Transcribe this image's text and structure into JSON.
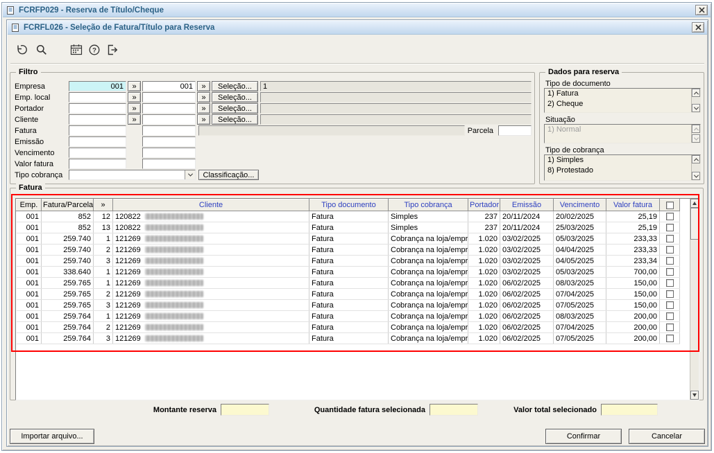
{
  "colors": {
    "annotation_red": "#ff0000",
    "link_blue": "#2d3fc0",
    "highlight_cyan": "#ccf4f6",
    "total_yellow": "#fcf9cf"
  },
  "window": {
    "title": "FCRFP029 - Reserva de Título/Cheque"
  },
  "dialog": {
    "title": "FCRFL026 - Seleção de Fatura/Título para Reserva"
  },
  "toolbar": {
    "icons": [
      "undo",
      "search",
      "calendar",
      "help",
      "exit"
    ]
  },
  "filtro": {
    "legend": "Filtro",
    "zoom_button": "»",
    "selecao_button": "Seleção...",
    "rows": [
      {
        "label": "Empresa",
        "from": "001",
        "to": "001",
        "detail": "1"
      },
      {
        "label": "Emp. local",
        "from": "",
        "to": "",
        "detail": ""
      },
      {
        "label": "Portador",
        "from": "",
        "to": "",
        "detail": ""
      },
      {
        "label": "Cliente",
        "from": "",
        "to": "",
        "detail": ""
      }
    ],
    "fatura_row": {
      "label": "Fatura",
      "from": "",
      "to": "",
      "parcela_label": "Parcela",
      "parcela_value": ""
    },
    "range_rows": [
      {
        "label": "Emissão",
        "from": "",
        "to": ""
      },
      {
        "label": "Vencimento",
        "from": "",
        "to": ""
      },
      {
        "label": "Valor fatura",
        "from": "",
        "to": ""
      }
    ],
    "tipo_cobranca": {
      "label": "Tipo cobrança",
      "value": "",
      "classificacao_button": "Classificação..."
    }
  },
  "dados_reserva": {
    "legend": "Dados para reserva",
    "sections": [
      {
        "label": "Tipo de documento",
        "options": [
          "1) Fatura",
          "2) Cheque"
        ],
        "disabled": false
      },
      {
        "label": "Situação",
        "options": [
          "1) Normal"
        ],
        "disabled": true
      },
      {
        "label": "Tipo de cobrança",
        "options": [
          "1) Simples",
          "8) Protestado"
        ],
        "disabled": false
      }
    ]
  },
  "fatura_grid": {
    "legend": "Fatura",
    "headers": [
      {
        "label": "Emp.",
        "link": false
      },
      {
        "label": "Fatura/Parcela",
        "link": false
      },
      {
        "label": "»",
        "link": false
      },
      {
        "label": "Cliente",
        "link": true
      },
      {
        "label": "Tipo documento",
        "link": true
      },
      {
        "label": "Tipo cobrança",
        "link": true
      },
      {
        "label": "Portador",
        "link": true
      },
      {
        "label": "Emissão",
        "link": true
      },
      {
        "label": "Vencimento",
        "link": true
      },
      {
        "label": "Valor fatura",
        "link": true
      }
    ],
    "rows": [
      {
        "emp": "001",
        "fatura": "852",
        "parcela": "12",
        "cliente": "120822",
        "tipo_documento": "Fatura",
        "tipo_cobranca": "Simples",
        "portador": "237",
        "emissao": "20/11/2024",
        "vencimento": "20/02/2025",
        "valor": "25,19",
        "checked": false
      },
      {
        "emp": "001",
        "fatura": "852",
        "parcela": "13",
        "cliente": "120822",
        "tipo_documento": "Fatura",
        "tipo_cobranca": "Simples",
        "portador": "237",
        "emissao": "20/11/2024",
        "vencimento": "25/03/2025",
        "valor": "25,19",
        "checked": false
      },
      {
        "emp": "001",
        "fatura": "259.740",
        "parcela": "1",
        "cliente": "121269",
        "tipo_documento": "Fatura",
        "tipo_cobranca": "Cobrança na loja/empre",
        "portador": "1.020",
        "emissao": "03/02/2025",
        "vencimento": "05/03/2025",
        "valor": "233,33",
        "checked": false
      },
      {
        "emp": "001",
        "fatura": "259.740",
        "parcela": "2",
        "cliente": "121269",
        "tipo_documento": "Fatura",
        "tipo_cobranca": "Cobrança na loja/empre",
        "portador": "1.020",
        "emissao": "03/02/2025",
        "vencimento": "04/04/2025",
        "valor": "233,33",
        "checked": false
      },
      {
        "emp": "001",
        "fatura": "259.740",
        "parcela": "3",
        "cliente": "121269",
        "tipo_documento": "Fatura",
        "tipo_cobranca": "Cobrança na loja/empre",
        "portador": "1.020",
        "emissao": "03/02/2025",
        "vencimento": "04/05/2025",
        "valor": "233,34",
        "checked": false
      },
      {
        "emp": "001",
        "fatura": "338.640",
        "parcela": "1",
        "cliente": "121269",
        "tipo_documento": "Fatura",
        "tipo_cobranca": "Cobrança na loja/empre",
        "portador": "1.020",
        "emissao": "03/02/2025",
        "vencimento": "05/03/2025",
        "valor": "700,00",
        "checked": false
      },
      {
        "emp": "001",
        "fatura": "259.765",
        "parcela": "1",
        "cliente": "121269",
        "tipo_documento": "Fatura",
        "tipo_cobranca": "Cobrança na loja/empre",
        "portador": "1.020",
        "emissao": "06/02/2025",
        "vencimento": "08/03/2025",
        "valor": "150,00",
        "checked": false
      },
      {
        "emp": "001",
        "fatura": "259.765",
        "parcela": "2",
        "cliente": "121269",
        "tipo_documento": "Fatura",
        "tipo_cobranca": "Cobrança na loja/empre",
        "portador": "1.020",
        "emissao": "06/02/2025",
        "vencimento": "07/04/2025",
        "valor": "150,00",
        "checked": false
      },
      {
        "emp": "001",
        "fatura": "259.765",
        "parcela": "3",
        "cliente": "121269",
        "tipo_documento": "Fatura",
        "tipo_cobranca": "Cobrança na loja/empre",
        "portador": "1.020",
        "emissao": "06/02/2025",
        "vencimento": "07/05/2025",
        "valor": "150,00",
        "checked": false
      },
      {
        "emp": "001",
        "fatura": "259.764",
        "parcela": "1",
        "cliente": "121269",
        "tipo_documento": "Fatura",
        "tipo_cobranca": "Cobrança na loja/empre",
        "portador": "1.020",
        "emissao": "06/02/2025",
        "vencimento": "08/03/2025",
        "valor": "200,00",
        "checked": false
      },
      {
        "emp": "001",
        "fatura": "259.764",
        "parcela": "2",
        "cliente": "121269",
        "tipo_documento": "Fatura",
        "tipo_cobranca": "Cobrança na loja/empre",
        "portador": "1.020",
        "emissao": "06/02/2025",
        "vencimento": "07/04/2025",
        "valor": "200,00",
        "checked": false
      },
      {
        "emp": "001",
        "fatura": "259.764",
        "parcela": "3",
        "cliente": "121269",
        "tipo_documento": "Fatura",
        "tipo_cobranca": "Cobrança na loja/empre",
        "portador": "1.020",
        "emissao": "06/02/2025",
        "vencimento": "07/05/2025",
        "valor": "200,00",
        "checked": false
      }
    ]
  },
  "totais": {
    "montante_label": "Montante reserva",
    "montante_value": "",
    "quantidade_label": "Quantidade fatura selecionada",
    "quantidade_value": "",
    "valor_total_label": "Valor total selecionado",
    "valor_total_value": ""
  },
  "actions": {
    "importar": "Importar arquivo...",
    "confirmar": "Confirmar",
    "cancelar": "Cancelar"
  }
}
